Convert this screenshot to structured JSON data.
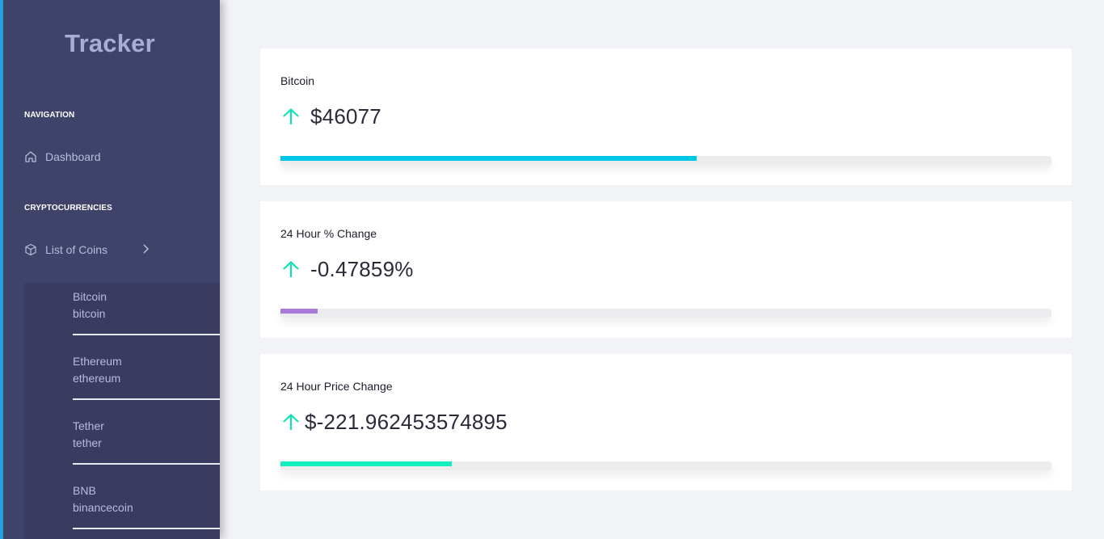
{
  "app": {
    "brand": "Tracker"
  },
  "sidebar": {
    "nav_heading": "NAVIGATION",
    "dashboard_label": "Dashboard",
    "crypto_heading": "CRYPTOCURRENCIES",
    "list_label": "List of Coins",
    "coins": [
      {
        "name": "Bitcoin",
        "id": "bitcoin"
      },
      {
        "name": "Ethereum",
        "id": "ethereum"
      },
      {
        "name": "Tether",
        "id": "tether"
      },
      {
        "name": "BNB",
        "id": "binancecoin"
      }
    ]
  },
  "cards": [
    {
      "title": "Bitcoin",
      "value": "$46077",
      "trend": "up",
      "progress": 0.54,
      "bar_color": "#00c7e6"
    },
    {
      "title": "24 Hour % Change",
      "value": "-0.47859%",
      "trend": "up",
      "progress": 0.048,
      "bar_color": "#a97ad9"
    },
    {
      "title": "24 Hour Price Change",
      "value": "$-221.962453574895",
      "trend": "up",
      "progress": 0.222,
      "bar_color": "#12f0c0"
    }
  ],
  "colors": {
    "trend_arrow": "#12e0b4",
    "sidebar_bg": "#3f4369",
    "accent": "#22a6e8"
  }
}
